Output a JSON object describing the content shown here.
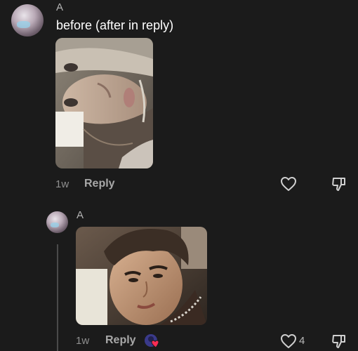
{
  "comment": {
    "author": "A",
    "text": "before (after in reply)",
    "time": "1w",
    "reply_label": "Reply"
  },
  "reply": {
    "author": "A",
    "time": "1w",
    "reply_label": "Reply",
    "like_count": "4"
  },
  "icons": {
    "like": "heart-outline-icon",
    "dislike": "thumbs-down-icon",
    "creator_like": "creator-liked-badge"
  },
  "colors": {
    "background": "#1b1b1b",
    "text_primary": "#ffffff",
    "text_secondary": "#8f8f8f",
    "badge_heart": "#fe2c55"
  }
}
